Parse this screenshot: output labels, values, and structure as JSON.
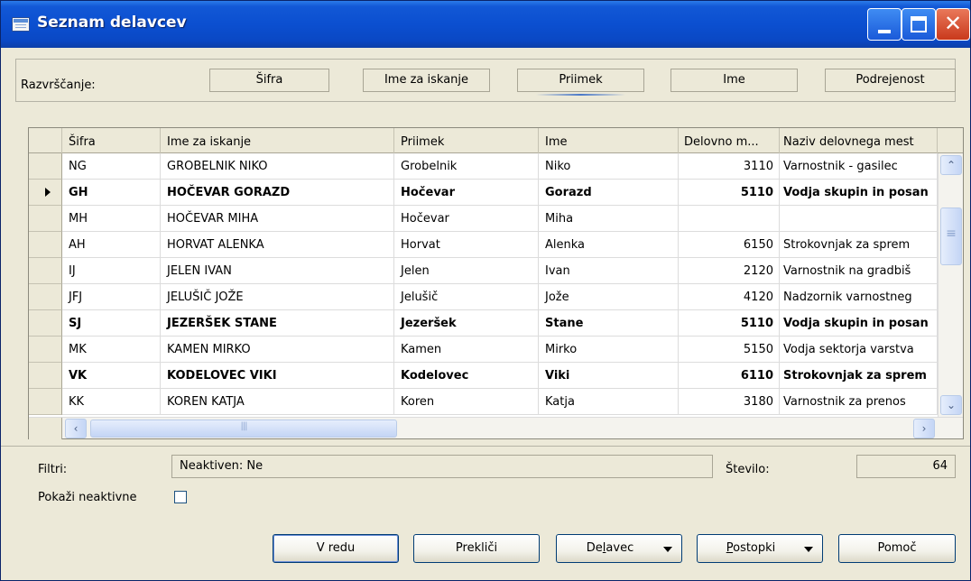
{
  "window": {
    "title": "Seznam delavcev"
  },
  "sort": {
    "label": "Razvrščanje:",
    "buttons": [
      "Šifra",
      "Ime za iskanje",
      "Priimek",
      "Ime",
      "Podrejenost"
    ],
    "active": "Priimek"
  },
  "table": {
    "columns": [
      "Šifra",
      "Ime za iskanje",
      "Priimek",
      "Ime",
      "Delovno m...",
      "Naziv delovnega mest"
    ],
    "rows": [
      {
        "sifra": "NG",
        "iskanje": "GROBELNIK NIKO",
        "priimek": "Grobelnik",
        "ime": "Niko",
        "delovno": "3110",
        "naziv": "Varnostnik - gasilec",
        "bold": false,
        "current": false
      },
      {
        "sifra": "GH",
        "iskanje": "HOČEVAR GORAZD",
        "priimek": "Hočevar",
        "ime": "Gorazd",
        "delovno": "5110",
        "naziv": "Vodja skupin in posan",
        "bold": true,
        "current": true
      },
      {
        "sifra": "MH",
        "iskanje": "HOČEVAR MIHA",
        "priimek": "Hočevar",
        "ime": "Miha",
        "delovno": "",
        "naziv": "",
        "bold": false,
        "current": false
      },
      {
        "sifra": "AH",
        "iskanje": "HORVAT ALENKA",
        "priimek": "Horvat",
        "ime": "Alenka",
        "delovno": "6150",
        "naziv": "Strokovnjak za sprem",
        "bold": false,
        "current": false
      },
      {
        "sifra": "IJ",
        "iskanje": "JELEN IVAN",
        "priimek": "Jelen",
        "ime": "Ivan",
        "delovno": "2120",
        "naziv": "Varnostnik na gradbiš",
        "bold": false,
        "current": false
      },
      {
        "sifra": "JFJ",
        "iskanje": "JELUŠIČ JOŽE",
        "priimek": "Jelušič",
        "ime": "Jože",
        "delovno": "4120",
        "naziv": "Nadzornik varnostneg",
        "bold": false,
        "current": false
      },
      {
        "sifra": "SJ",
        "iskanje": "JEZERŠEK STANE",
        "priimek": "Jezeršek",
        "ime": "Stane",
        "delovno": "5110",
        "naziv": "Vodja skupin in posan",
        "bold": true,
        "current": false
      },
      {
        "sifra": "MK",
        "iskanje": "KAMEN MIRKO",
        "priimek": "Kamen",
        "ime": "Mirko",
        "delovno": "5150",
        "naziv": "Vodja sektorja varstva",
        "bold": false,
        "current": false
      },
      {
        "sifra": "VK",
        "iskanje": "KODELOVEC VIKI",
        "priimek": "Kodelovec",
        "ime": "Viki",
        "delovno": "6110",
        "naziv": "Strokovnjak za sprem",
        "bold": true,
        "current": false
      },
      {
        "sifra": "KK",
        "iskanje": "KOREN KATJA",
        "priimek": "Koren",
        "ime": "Katja",
        "delovno": "3180",
        "naziv": "Varnostnik za prenos",
        "bold": false,
        "current": false
      }
    ]
  },
  "filter": {
    "label": "Filtri:",
    "value": "Neaktiven: Ne",
    "count_label": "Število:",
    "count_value": "64",
    "show_inactive_label": "Pokaži neaktivne",
    "show_inactive_checked": false
  },
  "buttons": {
    "ok": "V redu",
    "cancel": "Prekliči",
    "employee_pre": "De",
    "employee_u": "l",
    "employee_post": "avec",
    "actions_u": "P",
    "actions_post": "ostopki",
    "help": "Pomoč"
  }
}
